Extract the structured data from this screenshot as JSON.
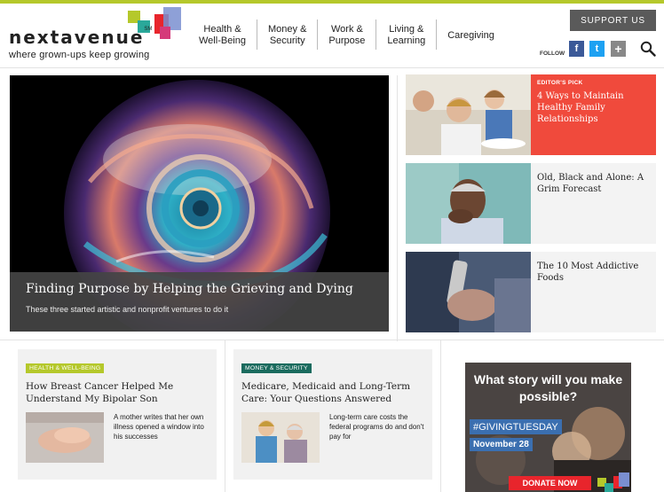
{
  "site": {
    "logo_text": "nextavenue",
    "logo_mark": "SM",
    "tagline": "where grown-ups keep growing"
  },
  "nav": {
    "items": [
      {
        "line1": "Health &",
        "line2": "Well-Being"
      },
      {
        "line1": "Money &",
        "line2": "Security"
      },
      {
        "line1": "Work &",
        "line2": "Purpose"
      },
      {
        "line1": "Living &",
        "line2": "Learning"
      },
      {
        "line1": "Caregiving",
        "line2": ""
      }
    ]
  },
  "header": {
    "support_label": "SUPPORT US",
    "follow_label": "FOLLOW",
    "social": [
      {
        "icon": "facebook-icon",
        "glyph": "f",
        "color": "#3b5998"
      },
      {
        "icon": "twitter-icon",
        "glyph": "t",
        "color": "#1da1f2"
      },
      {
        "icon": "plus-icon",
        "glyph": "+",
        "color": "#888888"
      }
    ],
    "search_icon": "search-icon"
  },
  "hero": {
    "title": "Finding Purpose by Helping the Grieving and Dying",
    "subtitle": "These three started artistic and nonprofit ventures to do it"
  },
  "side_stories": [
    {
      "label": "EDITOR'S PICK",
      "title": "4 Ways to Maintain Healthy Family Relationships"
    },
    {
      "label": "",
      "title": "Old, Black and Alone: A Grim Forecast"
    },
    {
      "label": "",
      "title": "The 10 Most Addictive Foods"
    }
  ],
  "cards": [
    {
      "badge": "HEALTH & WELL-BEING",
      "badge_color": "#b5c82b",
      "title": "How Breast Cancer Helped Me Understand My Bipolar Son",
      "summary": "A mother writes that her own illness opened a window into his successes"
    },
    {
      "badge": "MONEY & SECURITY",
      "badge_color": "#1a6b5e",
      "title": "Medicare, Medicaid and Long-Term Care: Your Questions Answered",
      "summary": "Long-term care costs the federal programs do and don't pay for"
    }
  ],
  "ad": {
    "headline": "What story will you make possible?",
    "tag": "#GIVINGTUESDAY",
    "date": "November 28",
    "button": "DONATE NOW"
  },
  "colors": {
    "accent_green": "#b5c82b",
    "editors_pick_red": "#f04a3c",
    "donate_red": "#e8252c"
  }
}
